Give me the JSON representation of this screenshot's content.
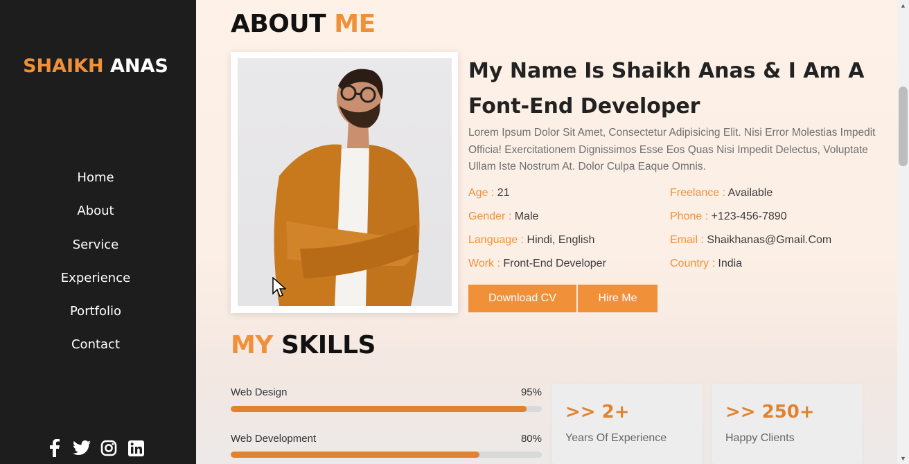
{
  "sidebar": {
    "logo_first": "SHAIKH",
    "logo_last": "ANAS",
    "nav": [
      "Home",
      "About",
      "Service",
      "Experience",
      "Portfolio",
      "Contact"
    ],
    "socials": [
      "facebook-icon",
      "twitter-icon",
      "instagram-icon",
      "linkedin-icon"
    ]
  },
  "about": {
    "heading_main": "ABOUT",
    "heading_accent": "ME",
    "title": "My Name Is Shaikh Anas & I Am A Font-End Developer",
    "description": "Lorem Ipsum Dolor Sit Amet, Consectetur Adipisicing Elit. Nisi Error Molestias Impedit Officia! Exercitationem Dignissimos Esse Eos Quas Nisi Impedit Delectus, Voluptate Ullam Iste Nostrum At. Dolor Culpa Eaque Omnis.",
    "info": [
      {
        "key": "Age :",
        "value": " 21"
      },
      {
        "key": "Freelance :",
        "value": " Available"
      },
      {
        "key": "Gender :",
        "value": " Male"
      },
      {
        "key": "Phone :",
        "value": " +123-456-7890"
      },
      {
        "key": "Language :",
        "value": " Hindi, English"
      },
      {
        "key": "Email :",
        "value": " Shaikhanas@Gmail.Com"
      },
      {
        "key": "Work :",
        "value": " Front-End Developer"
      },
      {
        "key": "Country :",
        "value": " India"
      }
    ],
    "buttons": {
      "download": "Download CV",
      "hire": "Hire Me"
    }
  },
  "skills": {
    "heading_accent": "MY",
    "heading_main": "SKILLS",
    "items": [
      {
        "name": "Web Design",
        "percent_label": "95%",
        "level": 0.95
      },
      {
        "name": "Web Development",
        "percent_label": "80%",
        "level": 0.8
      }
    ],
    "stats": [
      {
        "value": ">> 2+",
        "label": "Years Of Experience"
      },
      {
        "value": ">> 250+",
        "label": "Happy Clients"
      }
    ]
  },
  "colors": {
    "accent": "#f0913a",
    "sidebar_bg": "#1d1d1d"
  }
}
